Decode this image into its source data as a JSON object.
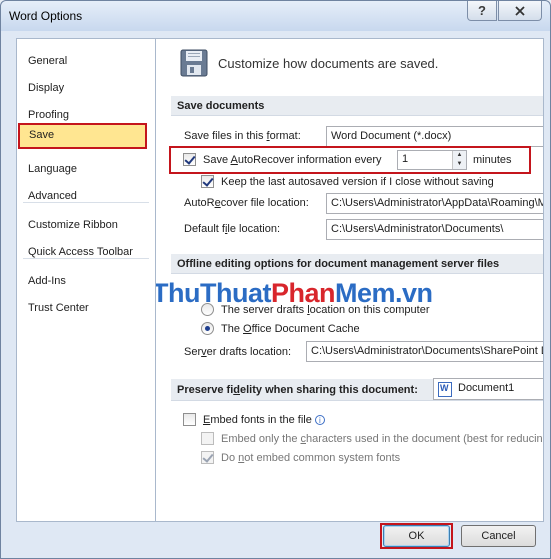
{
  "window": {
    "title": "Word Options",
    "help_glyph": "?",
    "close_glyph": "X"
  },
  "sidebar": {
    "items": [
      {
        "label": "General"
      },
      {
        "label": "Display"
      },
      {
        "label": "Proofing"
      },
      {
        "label": "Save",
        "selected": true
      },
      {
        "label": "Language"
      },
      {
        "label": "Advanced"
      },
      {
        "label": "Customize Ribbon"
      },
      {
        "label": "Quick Access Toolbar"
      },
      {
        "label": "Add-Ins"
      },
      {
        "label": "Trust Center"
      }
    ]
  },
  "main": {
    "header": "Customize how documents are saved.",
    "save_documents": {
      "heading": "Save documents",
      "format_label": "Save files in this format:",
      "format_value": "Word Document (*.docx)",
      "autorecover_label": "Save AutoRecover information every",
      "autorecover_checked": true,
      "autorecover_minutes": "1",
      "minutes_label": "minutes",
      "keep_last_label": "Keep the last autosaved version if I close without saving",
      "keep_last_checked": true,
      "autorecover_location_label": "AutoRecover file location:",
      "autorecover_location_value": "C:\\Users\\Administrator\\AppData\\Roaming\\Microsoft\\Word\\",
      "default_location_label": "Default file location:",
      "default_location_value": "C:\\Users\\Administrator\\Documents\\"
    },
    "offline": {
      "heading": "Offline editing options for document management server files",
      "option_server_drafts": "The server drafts location on this computer",
      "option_cache": "The Office Document Cache",
      "selected_option": "cache",
      "server_drafts_label": "Server drafts location:",
      "server_drafts_value": "C:\\Users\\Administrator\\Documents\\SharePoint Drafts\\"
    },
    "watermark": {
      "part1": "Thu",
      "part2": "Thuat",
      "part3": "Phan",
      "part4": "Mem",
      "part5": ".vn"
    },
    "fidelity": {
      "heading": "Preserve fidelity when sharing this document:",
      "document": "Document1",
      "embed_fonts": "Embed fonts in the file",
      "embed_fonts_checked": false,
      "embed_chars": "Embed only the characters used in the document (best for reducing file size)",
      "embed_chars_checked": false,
      "no_common": "Do not embed common system fonts",
      "no_common_checked": true
    }
  },
  "footer": {
    "ok": "OK",
    "cancel": "Cancel"
  },
  "colors": {
    "highlight_red": "#c4151c",
    "selected_nav_bg": "#ffe691",
    "watermark_blue": "#2b6cc4",
    "watermark_red": "#d8262c"
  }
}
